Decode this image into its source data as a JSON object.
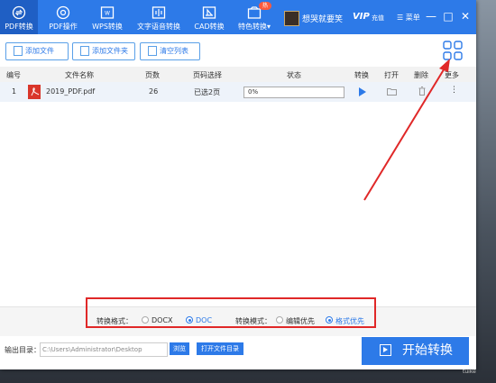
{
  "nav": {
    "tabs": [
      {
        "label": "PDF转换",
        "icon": "pdf-convert-icon",
        "active": true
      },
      {
        "label": "PDF操作",
        "icon": "pdf-operate-icon"
      },
      {
        "label": "WPS转换",
        "icon": "wps-icon"
      },
      {
        "label": "文字语音转换",
        "icon": "voice-icon"
      },
      {
        "label": "CAD转换",
        "icon": "cad-icon"
      },
      {
        "label": "特色转换",
        "icon": "special-convert-icon",
        "badge": "热"
      }
    ],
    "user_name": "想哭就要笑",
    "vip_label": "VIP",
    "recharge_label": "充值",
    "menu_label": "菜单",
    "minimize": "—",
    "restore": "□",
    "close": "✕"
  },
  "toolbar": {
    "add_file": "添加文件",
    "add_folder": "添加文件夹",
    "clear_list": "清空列表"
  },
  "table": {
    "headers": [
      "编号",
      "文件名称",
      "页数",
      "页码选择",
      "状态",
      "转换",
      "打开",
      "删除",
      "更多"
    ],
    "rows": [
      {
        "index": "1",
        "file_name": "2019_PDF.pdf",
        "pages": "26",
        "page_selection": "已选2页",
        "status": "0%"
      }
    ]
  },
  "options": {
    "format_label": "转换格式：",
    "format_options": [
      "DOCX",
      "DOC"
    ],
    "format_selected": "DOC",
    "mode_label": "转换模式：",
    "mode_options": [
      "编辑优先",
      "格式优先"
    ],
    "mode_selected": "格式优先"
  },
  "output": {
    "label": "输出目录：",
    "path": "C:\\Users\\Administrator\\Desktop",
    "browse": "浏览",
    "open_folder": "打开文件目录"
  },
  "start_button": "开始转换",
  "watermark": "tuike",
  "colors": {
    "primary": "#2d7ae8",
    "annotation_red": "#e02828"
  }
}
